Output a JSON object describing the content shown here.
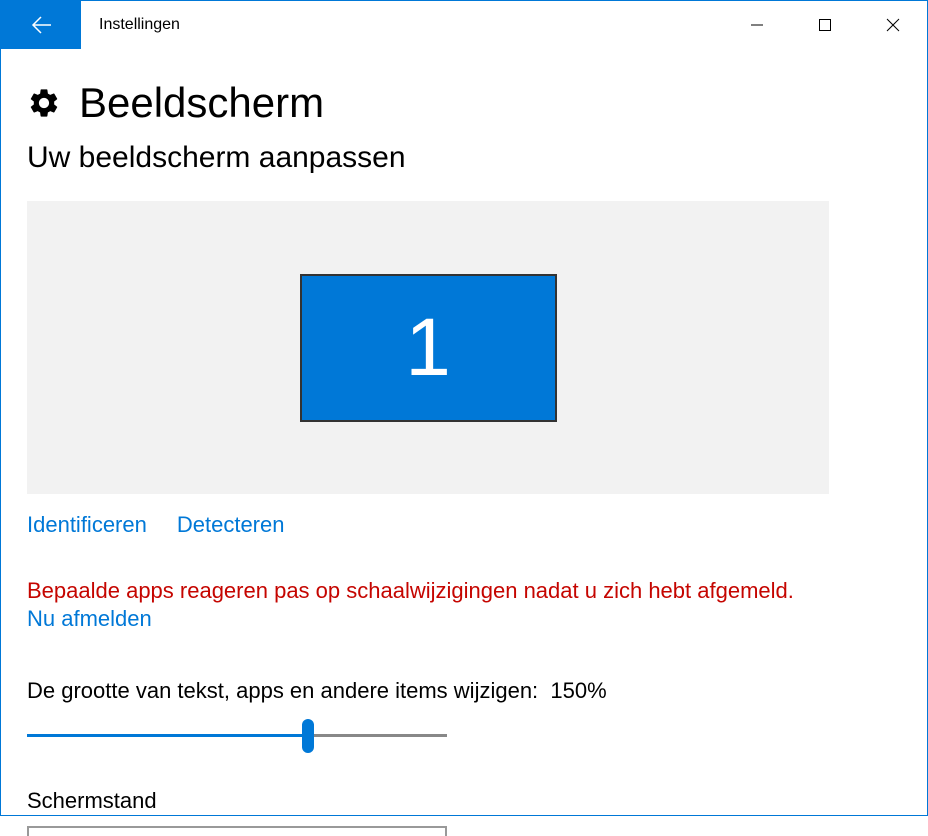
{
  "window": {
    "title": "Instellingen"
  },
  "page": {
    "title": "Beeldscherm",
    "subtitle": "Uw beeldscherm aanpassen"
  },
  "display": {
    "monitor_number": "1"
  },
  "links": {
    "identify": "Identificeren",
    "detect": "Detecteren",
    "signout": "Nu afmelden"
  },
  "messages": {
    "scale_warning": "Bepaalde apps reageren pas op schaalwijzigingen nadat u zich hebt afgemeld."
  },
  "slider": {
    "label": "De grootte van tekst, apps en andere items wijzigen:",
    "value": "150%"
  },
  "orientation": {
    "label": "Schermstand"
  }
}
